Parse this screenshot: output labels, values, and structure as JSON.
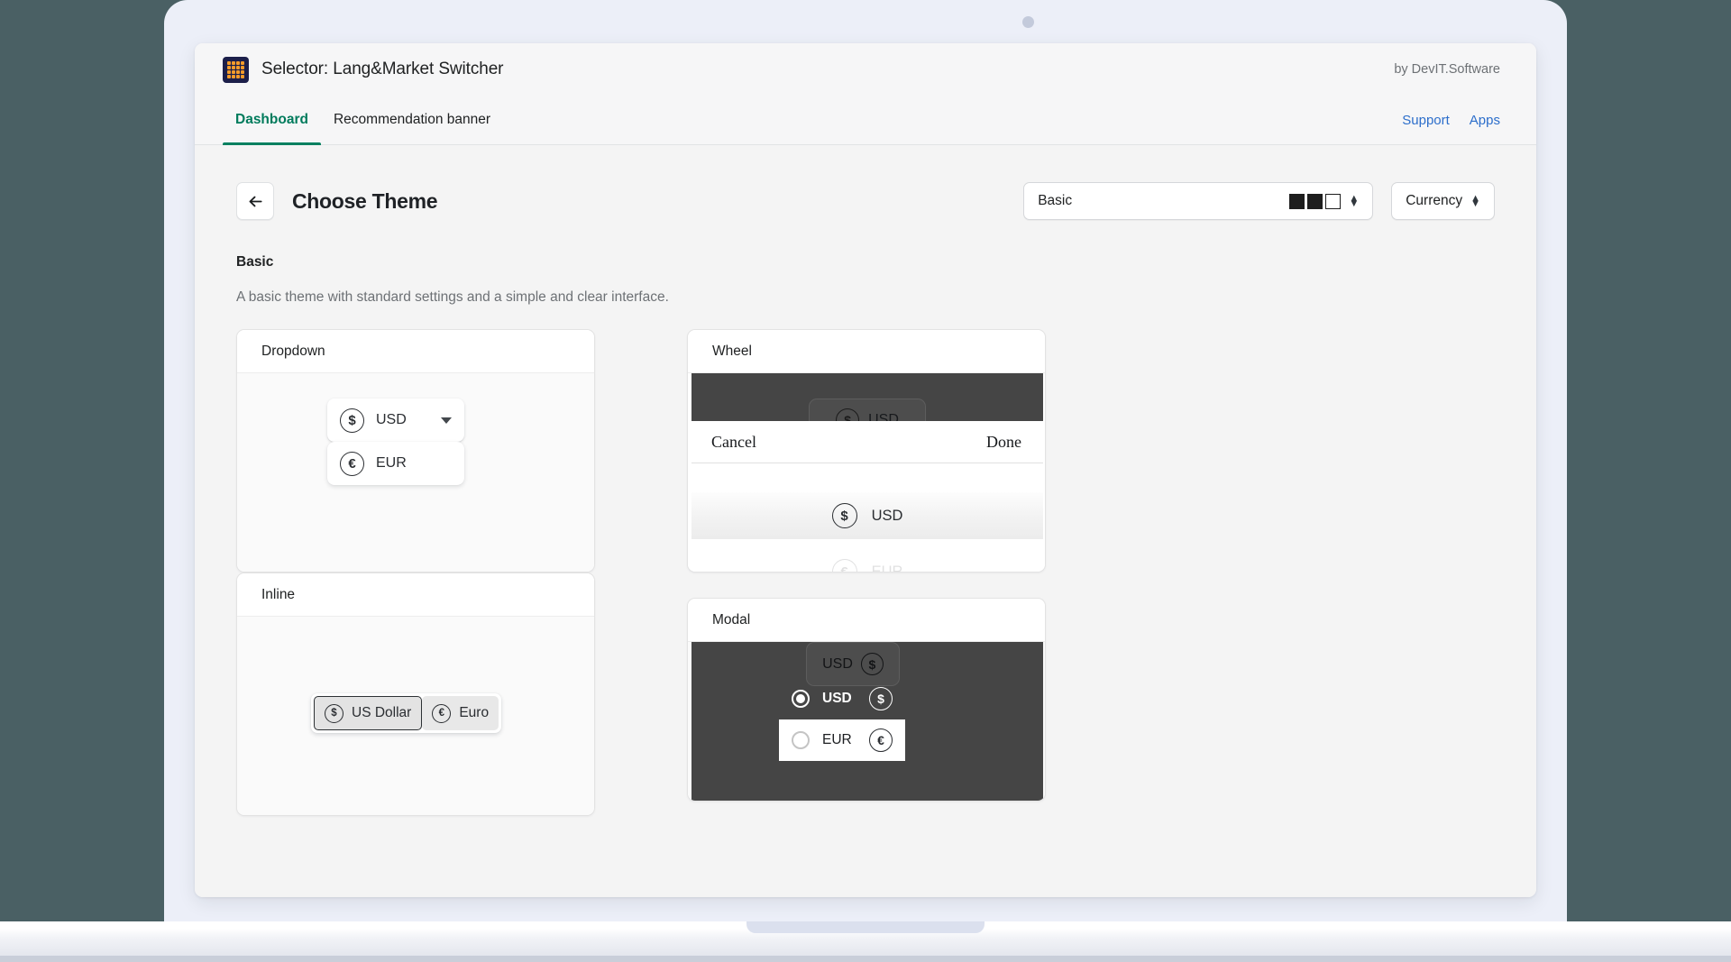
{
  "app": {
    "icon_name": "grid-app-icon",
    "title": "Selector: Lang&Market Switcher",
    "vendor": "by DevIT.Software"
  },
  "tabs": [
    {
      "label": "Dashboard",
      "active": true
    },
    {
      "label": "Recommendation banner",
      "active": false
    }
  ],
  "top_links": [
    {
      "label": "Support"
    },
    {
      "label": "Apps"
    }
  ],
  "page": {
    "back_icon": "arrow-left-icon",
    "title": "Choose Theme",
    "theme_select": {
      "value": "Basic",
      "swatches": [
        "#1e1e1e",
        "#1e1e1e",
        "#ffffff"
      ],
      "arrow_glyph": "↕"
    },
    "currency_select": {
      "value": "Currency",
      "arrow_glyph": "↕"
    }
  },
  "section": {
    "title": "Basic",
    "description": "A basic theme with standard settings and a simple and clear interface."
  },
  "cards": {
    "dropdown": {
      "header": "Dropdown",
      "trigger": {
        "symbol": "$",
        "label": "USD",
        "caret_icon": "chevron-down-icon"
      },
      "option": {
        "symbol": "€",
        "label": "EUR"
      }
    },
    "wheel": {
      "header": "Wheel",
      "ghost_chip": {
        "symbol": "$",
        "label": "USD"
      },
      "cancel_label": "Cancel",
      "done_label": "Done",
      "rows": [
        {
          "symbol": "$",
          "label": "USD",
          "selected": true
        },
        {
          "symbol": "€",
          "label": "EUR",
          "selected": false
        }
      ]
    },
    "inline": {
      "header": "Inline",
      "segments": [
        {
          "symbol": "$",
          "label": "US Dollar",
          "selected": true
        },
        {
          "symbol": "€",
          "label": "Euro",
          "selected": false
        }
      ]
    },
    "modal": {
      "header": "Modal",
      "ghost_chip": {
        "label": "USD",
        "symbol": "$"
      },
      "options": [
        {
          "label": "USD",
          "symbol": "$",
          "selected": true
        },
        {
          "label": "EUR",
          "symbol": "€",
          "selected": false
        }
      ]
    }
  }
}
